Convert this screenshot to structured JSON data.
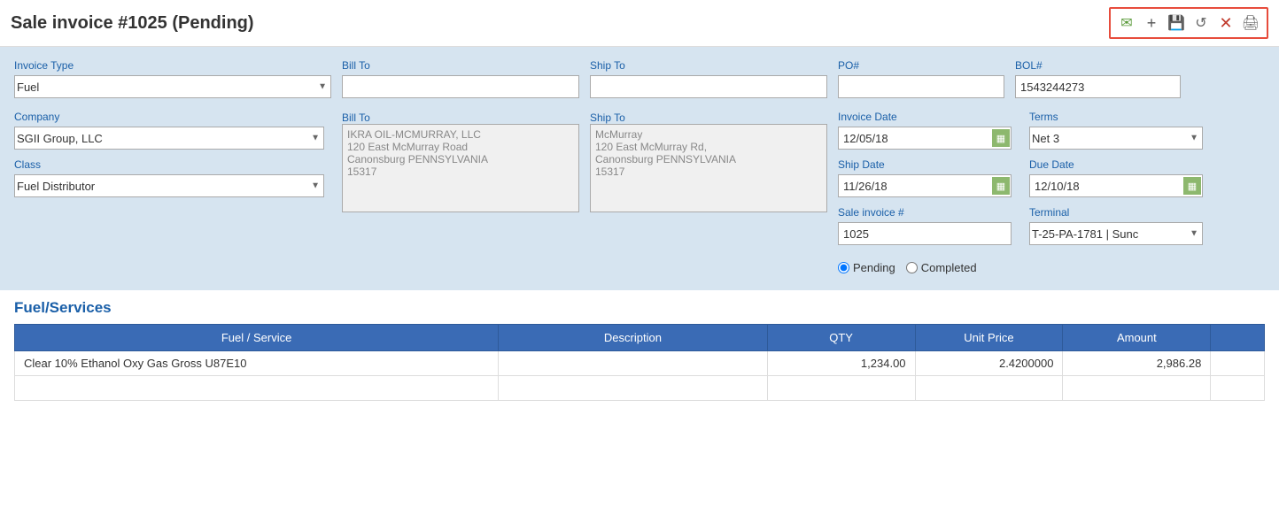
{
  "header": {
    "title": "Sale invoice #1025 (Pending)",
    "actions": {
      "email": "✉",
      "add": "+",
      "save": "💾",
      "undo": "↺",
      "close": "✕",
      "print": "🖨"
    }
  },
  "form": {
    "invoice_type_label": "Invoice Type",
    "invoice_type_value": "Fuel",
    "company_label": "Company",
    "company_value": "SGII Group, LLC",
    "class_label": "Class",
    "class_value": "Fuel Distributor",
    "bill_to_label": "Bill To",
    "bill_to_value": "",
    "bill_to_textarea": "IKRA OIL-MCMURRAY, LLC\n120 East McMurray Road\nCanonsburg PENNSYLVANIA\n15317",
    "ship_to_label": "Ship To",
    "ship_to_value": "",
    "ship_to_textarea": "McMurray\n120 East McMurray Rd,\nCanonsburg PENNSYLVANIA\n15317",
    "po_label": "PO#",
    "po_value": "",
    "bol_label": "BOL#",
    "bol_value": "1543244273",
    "invoice_date_label": "Invoice Date",
    "invoice_date_value": "12/05/18",
    "terms_label": "Terms",
    "terms_value": "Net 3",
    "ship_date_label": "Ship Date",
    "ship_date_value": "11/26/18",
    "due_date_label": "Due Date",
    "due_date_value": "12/10/18",
    "sale_invoice_label": "Sale invoice #",
    "sale_invoice_value": "1025",
    "terminal_label": "Terminal",
    "terminal_value": "T-25-PA-1781 | Sunc",
    "status_pending": "Pending",
    "status_completed": "Completed"
  },
  "services": {
    "section_title": "Fuel/Services",
    "table_headers": {
      "fuel_service": "Fuel / Service",
      "description": "Description",
      "qty": "QTY",
      "unit_price": "Unit Price",
      "amount": "Amount"
    },
    "rows": [
      {
        "fuel_service": "Clear 10% Ethanol Oxy Gas Gross U87E10",
        "description": "",
        "qty": "1,234.00",
        "unit_price": "2.4200000",
        "amount": "2,986.28"
      },
      {
        "fuel_service": "",
        "description": "",
        "qty": "",
        "unit_price": "",
        "amount": ""
      }
    ]
  }
}
